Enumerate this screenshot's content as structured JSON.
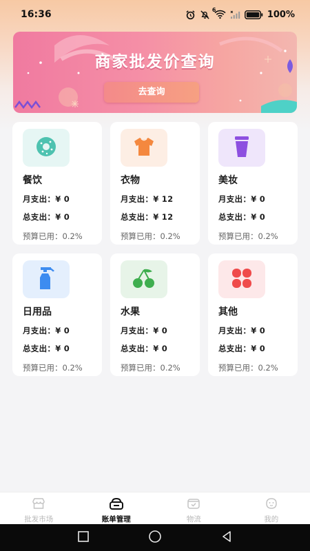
{
  "status_bar": {
    "time": "16:36",
    "network_badge": "6",
    "battery": "100%",
    "icons": [
      "alarm-icon",
      "mute-icon",
      "wifi-icon",
      "signal-icon",
      "battery-icon"
    ]
  },
  "banner": {
    "title": "商家批发价查询",
    "button_label": "去查询"
  },
  "categories": [
    {
      "name": "餐饮",
      "monthly": "月支出：¥ 0",
      "total": "总支出：¥ 0",
      "budget": "预算已用：0.2%",
      "icon": "donut-icon",
      "icon_color": "#4ec2b0",
      "icon_bg": "#e6f6f4"
    },
    {
      "name": "衣物",
      "monthly": "月支出：¥ 12",
      "total": "总支出：¥ 12",
      "budget": "预算已用：0.2%",
      "icon": "tshirt-icon",
      "icon_color": "#f4883f",
      "icon_bg": "#fdeee4"
    },
    {
      "name": "美妆",
      "monthly": "月支出：¥ 0",
      "total": "总支出：¥ 0",
      "budget": "预算已用：0.2%",
      "icon": "cosmetic-cup-icon",
      "icon_color": "#8d50e0",
      "icon_bg": "#efe6fb"
    },
    {
      "name": "日用品",
      "monthly": "月支出：¥ 0",
      "total": "总支出：¥ 0",
      "budget": "预算已用：0.2%",
      "icon": "spray-bottle-icon",
      "icon_color": "#3d8cf0",
      "icon_bg": "#e4effd"
    },
    {
      "name": "水果",
      "monthly": "月支出：¥ 0",
      "total": "总支出：¥ 0",
      "budget": "预算已用：0.2%",
      "icon": "cherry-icon",
      "icon_color": "#3fae4f",
      "icon_bg": "#e7f4e8"
    },
    {
      "name": "其他",
      "monthly": "月支出：¥ 0",
      "total": "总支出：¥ 0",
      "budget": "预算已用：0.2%",
      "icon": "four-petal-icon",
      "icon_color": "#ef4b4b",
      "icon_bg": "#fde8e9"
    }
  ],
  "tabbar": {
    "items": [
      {
        "label": "批发市场",
        "icon": "store-icon",
        "active": false
      },
      {
        "label": "账单管理",
        "icon": "wallet-icon",
        "active": true
      },
      {
        "label": "物流",
        "icon": "box-icon",
        "active": false
      },
      {
        "label": "我的",
        "icon": "profile-icon",
        "active": false
      }
    ]
  },
  "colors": {
    "background": "#f4f4f6",
    "banner_start": "#f07aa0",
    "banner_end": "#f3b7b0",
    "active_tab": "#111111",
    "inactive_tab": "#b9b9b9"
  },
  "nav_buttons": [
    "recents-square-icon",
    "home-circle-icon",
    "back-triangle-icon"
  ]
}
